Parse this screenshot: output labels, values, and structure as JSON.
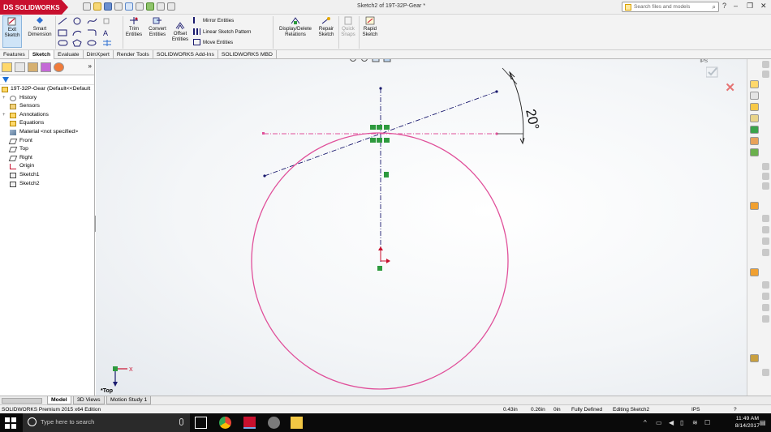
{
  "app": {
    "logo_brand": "DS",
    "logo_text": "SOLIDWORKS",
    "doc_title": "Sketch2 of 19T-32P-Gear *"
  },
  "search": {
    "placeholder": "Search files and models"
  },
  "window_controls": {
    "minimize": "–",
    "restore": "❐",
    "close": "✕",
    "help": "?"
  },
  "commands": {
    "exit_sketch": "Exit Sketch",
    "smart_dimension": "Smart Dimension",
    "trim_entities": "Trim Entities",
    "convert_entities": "Convert Entities",
    "offset_entities": "Offset Entities",
    "mirror_entities": "Mirror Entities",
    "linear_sketch_pattern": "Linear Sketch Pattern",
    "move_entities": "Move Entities",
    "display_delete_relations": "Display/Delete Relations",
    "repair_sketch": "Repair Sketch",
    "quick_snaps": "Quick Snaps",
    "rapid_sketch": "Rapid Sketch"
  },
  "tabs": [
    "Features",
    "Sketch",
    "Evaluate",
    "DimXpert",
    "Render Tools",
    "SOLIDWORKS Add-Ins",
    "SOLIDWORKS MBD"
  ],
  "active_tab": "Sketch",
  "feature_tree": {
    "root": "19T-32P-Gear  (Default<<Default",
    "items": [
      "History",
      "Sensors",
      "Annotations",
      "Equations",
      "Material <not specified>",
      "Front",
      "Top",
      "Right",
      "Origin",
      "Sketch1",
      "Sketch2"
    ]
  },
  "graphics": {
    "dimension_label": "20°",
    "view_label": "*Top",
    "triad_x": "X",
    "ips": "IPS"
  },
  "model_tabs": [
    "Model",
    "3D Views",
    "Motion Study 1"
  ],
  "status": {
    "edition": "SOLIDWORKS Premium 2015 x64 Edition",
    "x": "0.43in",
    "y": "0.26in",
    "z": "0in",
    "state": "Fully Defined",
    "editing": "Editing Sketch2",
    "units": "IPS",
    "help": "?"
  },
  "taskbar": {
    "search_placeholder": "Type here to search",
    "time": "11:49 AM",
    "date": "8/14/2017"
  },
  "colors": {
    "brand_red": "#c8102e",
    "sketch_pink": "#e0509a",
    "construction_blue": "#1a1a6e",
    "relation_green": "#2e9a3e"
  }
}
